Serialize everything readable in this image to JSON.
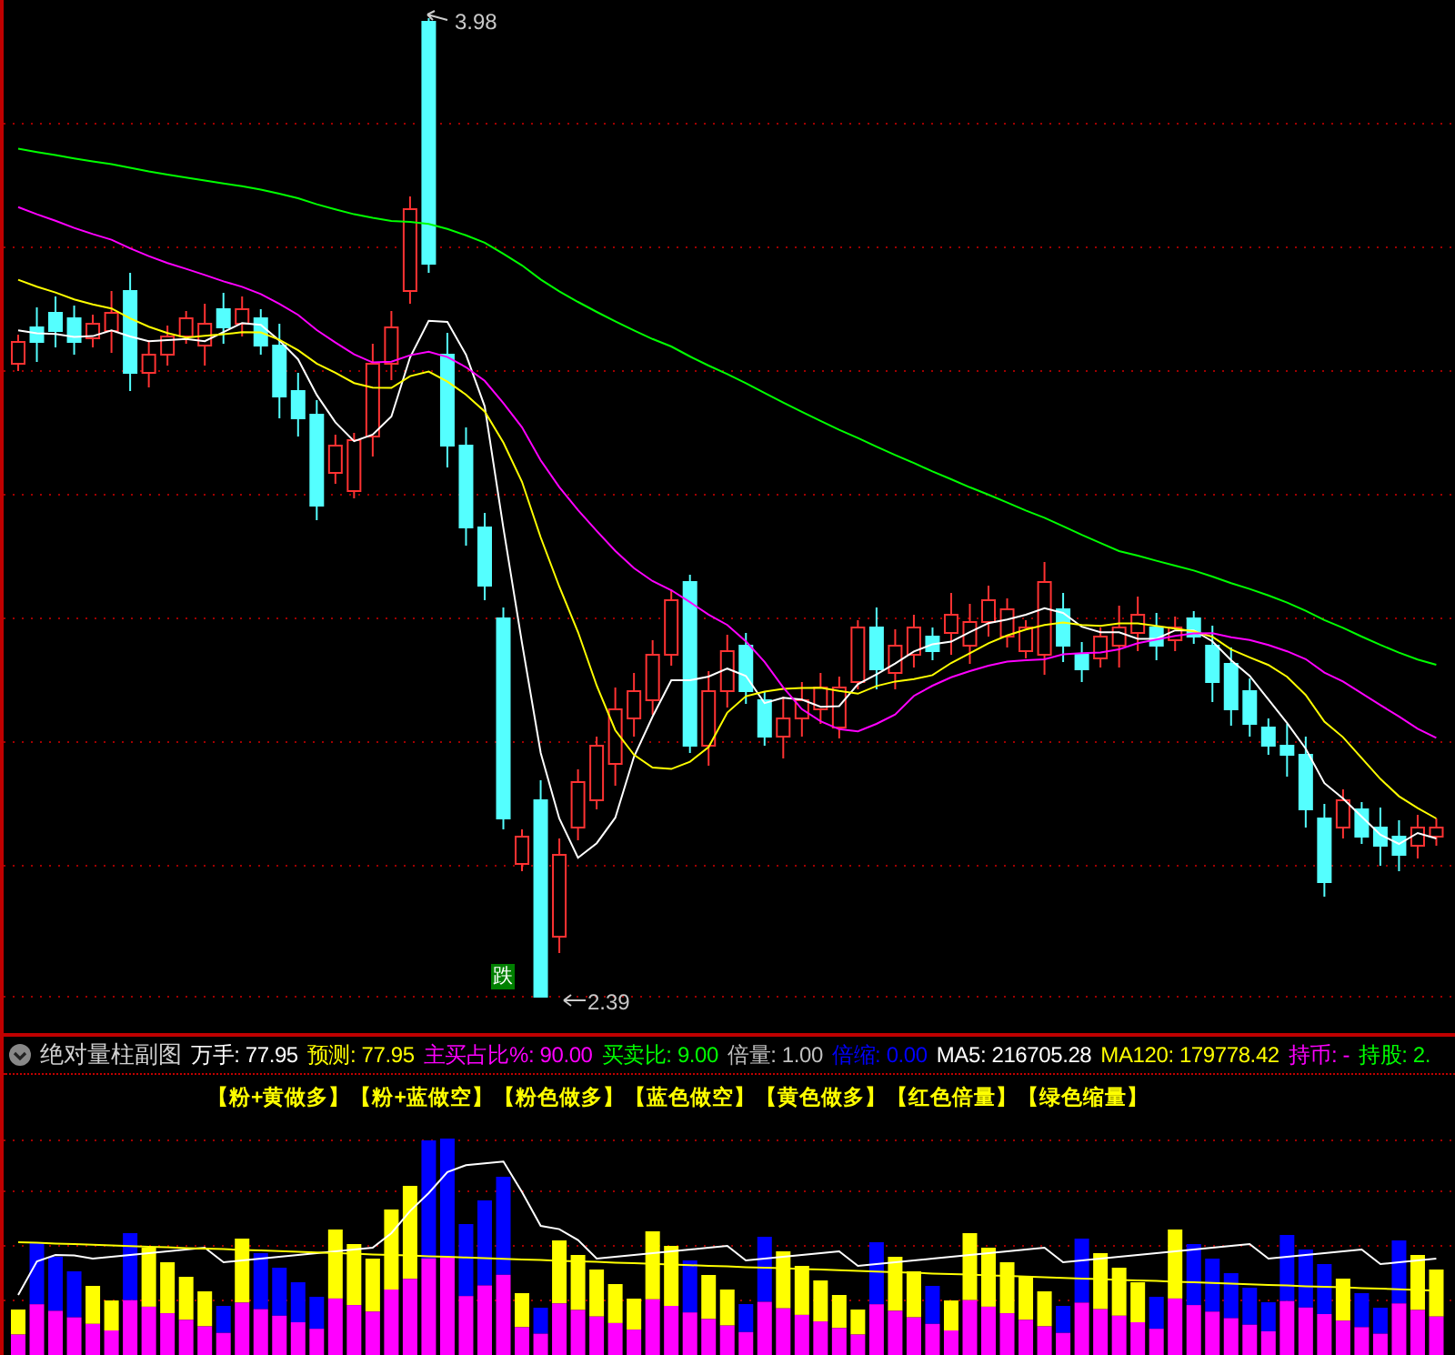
{
  "main_chart": {
    "high_label": "3.98",
    "low_label": "2.39",
    "signal_badge": "跌"
  },
  "indicator_bar": {
    "title": "绝对量柱副图",
    "readouts": [
      {
        "text": "万手: 77.95",
        "color": "#ffffff"
      },
      {
        "text": "预测: 77.95",
        "color": "#ffff00"
      },
      {
        "text": "主买占比%: 90.00",
        "color": "#ff00ff"
      },
      {
        "text": "买卖比: 9.00",
        "color": "#00ff00"
      },
      {
        "text": "倍量: 1.00",
        "color": "#c0c0c0"
      },
      {
        "text": "倍缩: 0.00",
        "color": "#0000ff"
      },
      {
        "text": "MA5: 216705.28",
        "color": "#ffffff"
      },
      {
        "text": "MA120: 179778.42",
        "color": "#ffff00"
      },
      {
        "text": "持币: -",
        "color": "#ff00ff"
      },
      {
        "text": "持股: 2.",
        "color": "#00ff00"
      }
    ]
  },
  "legend": [
    "【粉+黄做多】",
    "【粉+蓝做空】",
    "【粉色做多】",
    "【蓝色做空】",
    "【黄色做多】",
    "【红色倍量】",
    "【绿色缩量】"
  ]
}
